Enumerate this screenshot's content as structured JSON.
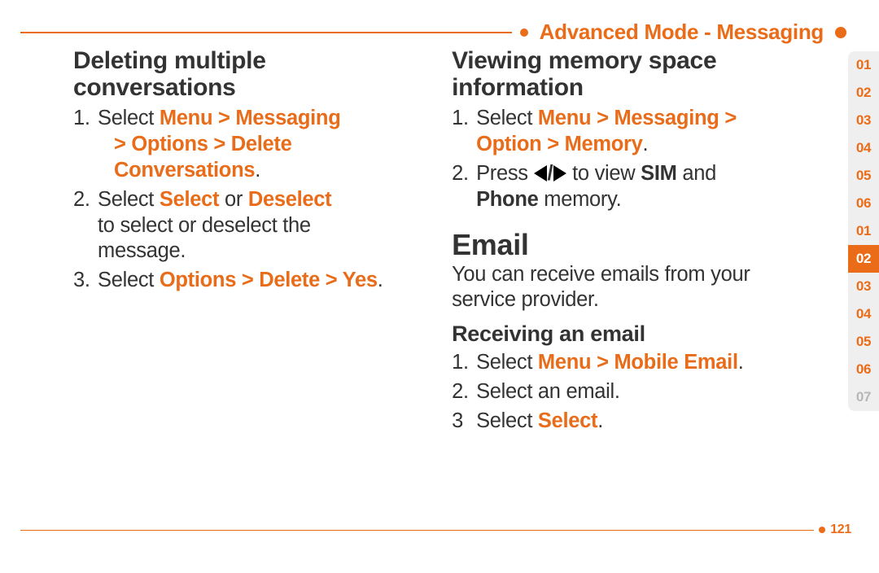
{
  "header": {
    "title": "Advanced Mode - Messaging"
  },
  "left": {
    "heading_l1": "Deleting multiple",
    "heading_l2": "conversations",
    "step1_pre": "Select ",
    "step1_path_a": "Menu > Messaging",
    "step1_path_b": "> Options > Delete",
    "step1_path_c": "Conversations",
    "step2_pre": "Select ",
    "step2_b1": "Select",
    "step2_or": " or ",
    "step2_b2": "Deselect",
    "step2_tail_a": "to select or deselect the",
    "step2_tail_b": "message.",
    "step3_pre": "Select ",
    "step3_path": "Options > Delete > Yes"
  },
  "right": {
    "mem_h_l1": "Viewing memory space",
    "mem_h_l2": "information",
    "mem_s1_pre": "Select ",
    "mem_s1_path_a": "Menu > Messaging >",
    "mem_s1_path_b": "Option > Memory",
    "mem_s2_pre": "Press ",
    "mem_s2_mid": " to view ",
    "mem_s2_sim": "SIM",
    "mem_s2_and": " and",
    "mem_s2_phone": "Phone",
    "mem_s2_tail": " memory.",
    "email_h": "Email",
    "email_p_a": "You can receive emails from your",
    "email_p_b": "service provider.",
    "recv_h": "Receiving an email",
    "recv_s1_pre": "Select ",
    "recv_s1_path": "Menu > Mobile Email",
    "recv_s2": "Select an email.",
    "recv_s3_pre": "Select ",
    "recv_s3_b": "Select"
  },
  "tabs": [
    "01",
    "02",
    "03",
    "04",
    "05",
    "06",
    "01",
    "02",
    "03",
    "04",
    "05",
    "06",
    "07"
  ],
  "tabs_active_index": 7,
  "tabs_dim_from": 12,
  "page_number": "121"
}
